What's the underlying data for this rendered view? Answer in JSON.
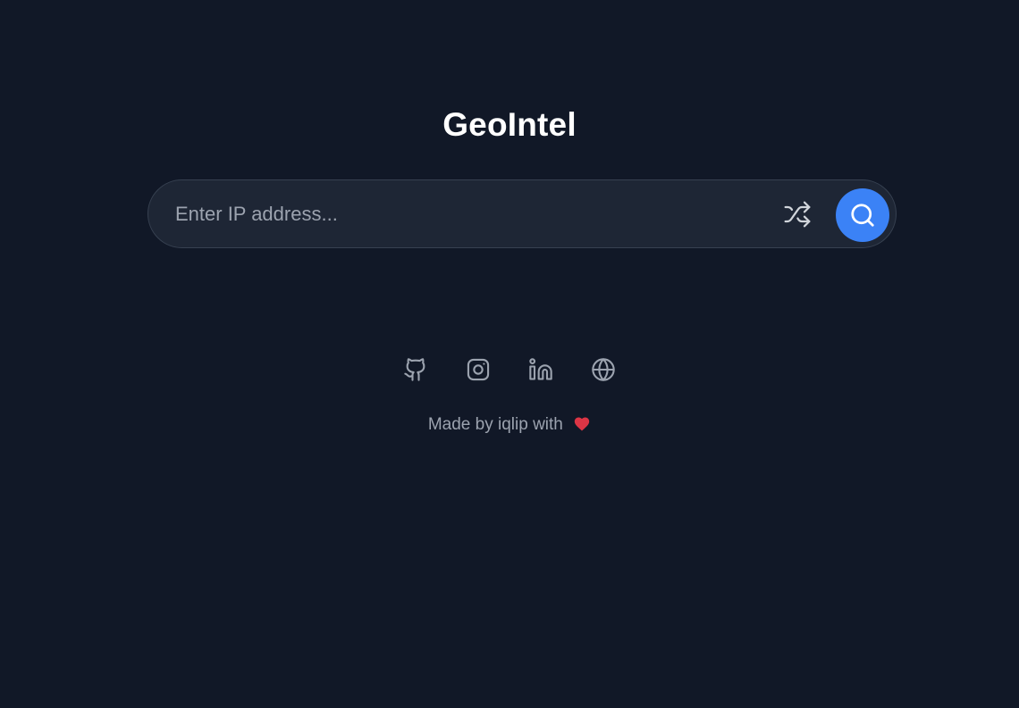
{
  "app": {
    "title": "GeoIntel"
  },
  "search": {
    "placeholder": "Enter IP address...",
    "value": ""
  },
  "actions": {
    "shuffle_icon": "shuffle-icon",
    "search_icon": "search-icon"
  },
  "socials": [
    {
      "icon": "github-icon"
    },
    {
      "icon": "instagram-icon"
    },
    {
      "icon": "linkedin-icon"
    },
    {
      "icon": "globe-icon"
    }
  ],
  "footer": {
    "text": "Made by iqlip with",
    "heart_icon": "heart-icon"
  },
  "colors": {
    "background": "#111827",
    "accent": "#3b82f6",
    "heart": "#dc3545",
    "muted": "#9ca3af"
  }
}
